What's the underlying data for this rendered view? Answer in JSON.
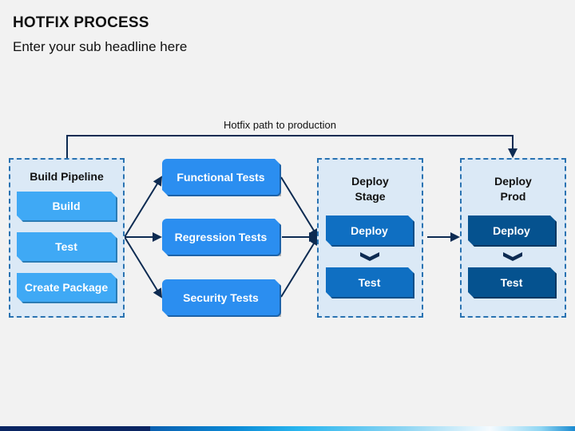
{
  "header": {
    "title": "HOTFIX PROCESS",
    "subtitle": "Enter your sub headline here"
  },
  "hotfix_path": {
    "label": "Hotfix path to production"
  },
  "build_pipeline": {
    "title": "Build Pipeline",
    "steps": [
      "Build",
      "Test",
      "Create Package"
    ]
  },
  "tests": {
    "items": [
      "Functional Tests",
      "Regression Tests",
      "Security Tests"
    ]
  },
  "deploy_stage": {
    "title_line1": "Deploy",
    "title_line2": "Stage",
    "steps": [
      "Deploy",
      "Test"
    ]
  },
  "deploy_prod": {
    "title_line1": "Deploy",
    "title_line2": "Prod",
    "steps": [
      "Deploy",
      "Test"
    ]
  },
  "colors": {
    "build_steps": "#3fa9f5",
    "test_boxes": "#2b8ef0",
    "stage_boxes": "#0f6fc2",
    "prod_boxes": "#05528f",
    "group_border": "#2a73b2",
    "group_fill": "#dbe9f6",
    "connector": "#0d2b52"
  }
}
